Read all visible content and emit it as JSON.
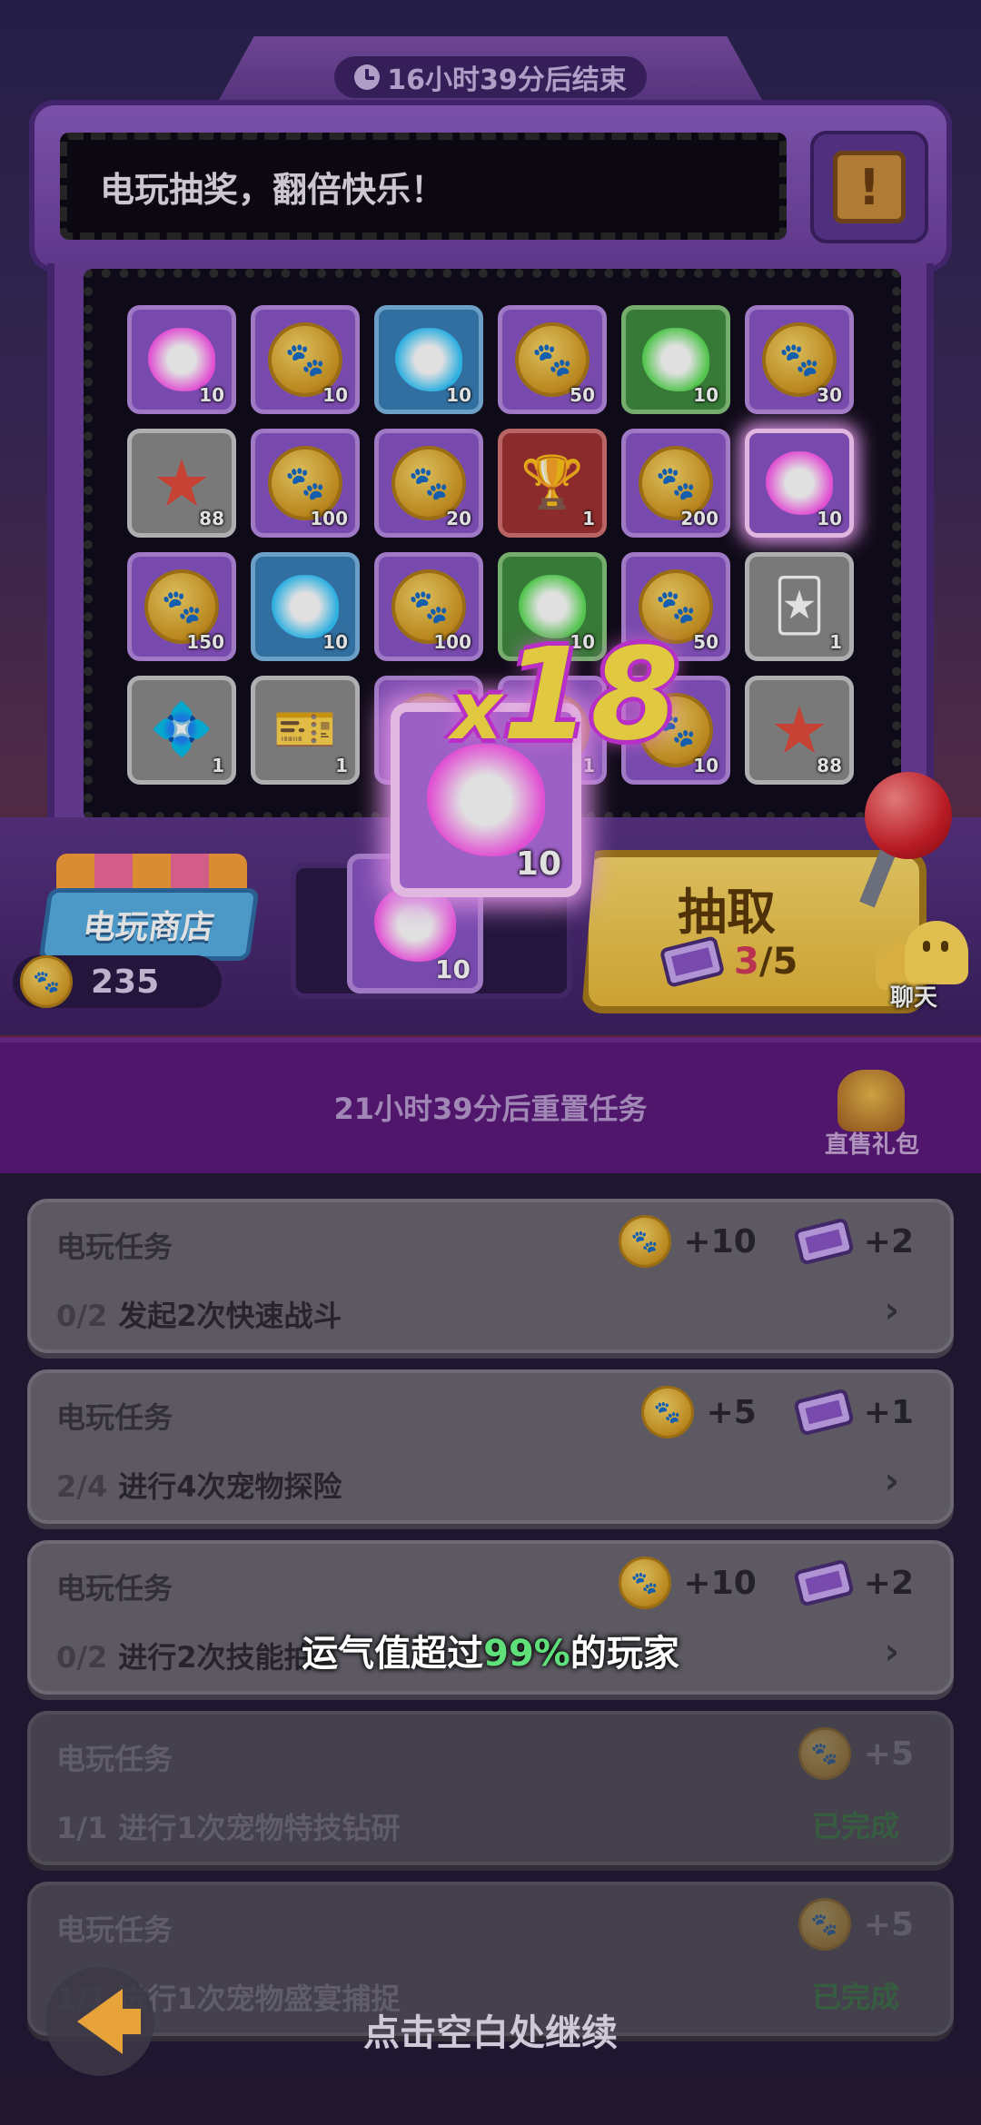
{
  "header": {
    "timer_text": "16小时39分后结束",
    "banner_text": "电玩抽奖，翻倍快乐！",
    "alert_symbol": "!"
  },
  "grid": [
    {
      "type": "blob",
      "color": "#ff5cf0",
      "tile": "purple",
      "qty": "10"
    },
    {
      "type": "coin",
      "tile": "purple",
      "qty": "10"
    },
    {
      "type": "blob",
      "color": "#35c8ff",
      "tile": "blue",
      "qty": "10"
    },
    {
      "type": "coin",
      "tile": "purple",
      "qty": "50"
    },
    {
      "type": "blob",
      "color": "#5fe05a",
      "tile": "green",
      "qty": "10"
    },
    {
      "type": "coin",
      "tile": "purple",
      "qty": "30"
    },
    {
      "type": "star",
      "tile": "gray",
      "qty": "88"
    },
    {
      "type": "coin",
      "tile": "purple",
      "qty": "100"
    },
    {
      "type": "coin",
      "tile": "purple",
      "qty": "20"
    },
    {
      "type": "trophy",
      "tile": "red",
      "qty": "1"
    },
    {
      "type": "coin",
      "tile": "purple",
      "qty": "200"
    },
    {
      "type": "blob",
      "color": "#ff5cf0",
      "tile": "purple glow",
      "qty": "10"
    },
    {
      "type": "coin",
      "tile": "purple",
      "qty": "150"
    },
    {
      "type": "blob",
      "color": "#35c8ff",
      "tile": "blue",
      "qty": "10"
    },
    {
      "type": "coin",
      "tile": "purple",
      "qty": "100"
    },
    {
      "type": "blob",
      "color": "#5fe05a",
      "tile": "green",
      "qty": "10"
    },
    {
      "type": "coin",
      "tile": "purple",
      "qty": "50"
    },
    {
      "type": "card",
      "tile": "gray",
      "qty": "1"
    },
    {
      "type": "crystal",
      "tile": "gray",
      "qty": "1"
    },
    {
      "type": "ticket",
      "tile": "gray",
      "qty": "1"
    },
    {
      "type": "coin",
      "tile": "purple",
      "qty": ""
    },
    {
      "type": "coin",
      "tile": "purple",
      "qty": "1"
    },
    {
      "type": "coin",
      "tile": "purple",
      "qty": "10"
    },
    {
      "type": "star",
      "tile": "gray",
      "qty": "88"
    }
  ],
  "reward": {
    "multiplier_prefix": "x",
    "multiplier_value": "18",
    "qty": "10"
  },
  "shop": {
    "label": "电玩商店",
    "coin_balance": "235"
  },
  "slot": {
    "qty": "10"
  },
  "draw": {
    "label": "抽取",
    "tickets_current": "3",
    "tickets_total": "/5"
  },
  "chat": {
    "label": "聊天"
  },
  "reset": {
    "text": "21小时39分后重置任务",
    "gift_label": "直售礼包"
  },
  "tasks": [
    {
      "title": "电玩任务",
      "progress": "0/2",
      "desc": "发起2次快速战斗",
      "coin_reward": "+10",
      "ticket_reward": "+2",
      "done": false,
      "status": ""
    },
    {
      "title": "电玩任务",
      "progress": "2/4",
      "desc": "进行4次宠物探险",
      "coin_reward": "+5",
      "ticket_reward": "+1",
      "done": false,
      "status": ""
    },
    {
      "title": "电玩任务",
      "progress": "0/2",
      "desc": "进行2次技能拍",
      "coin_reward": "+10",
      "ticket_reward": "+2",
      "done": false,
      "status": ""
    },
    {
      "title": "电玩任务",
      "progress": "1/1",
      "desc": "进行1次宠物特技钻研",
      "coin_reward": "+5",
      "ticket_reward": "",
      "done": true,
      "status": "已完成"
    },
    {
      "title": "电玩任务",
      "progress": "1/1",
      "desc": "进行1次宠物盛宴捕捉",
      "coin_reward": "+5",
      "ticket_reward": "",
      "done": true,
      "status": "已完成"
    }
  ],
  "overlay": {
    "luck_prefix": "运气值超过",
    "luck_pct": "99%",
    "luck_suffix": "的玩家",
    "continue_hint": "点击空白处继续"
  },
  "icons": {
    "clock": "clock-icon",
    "alert": "scroll-alert-icon",
    "coin": "paw-coin-icon",
    "ticket": "ticket-icon",
    "back": "back-arrow-icon"
  }
}
